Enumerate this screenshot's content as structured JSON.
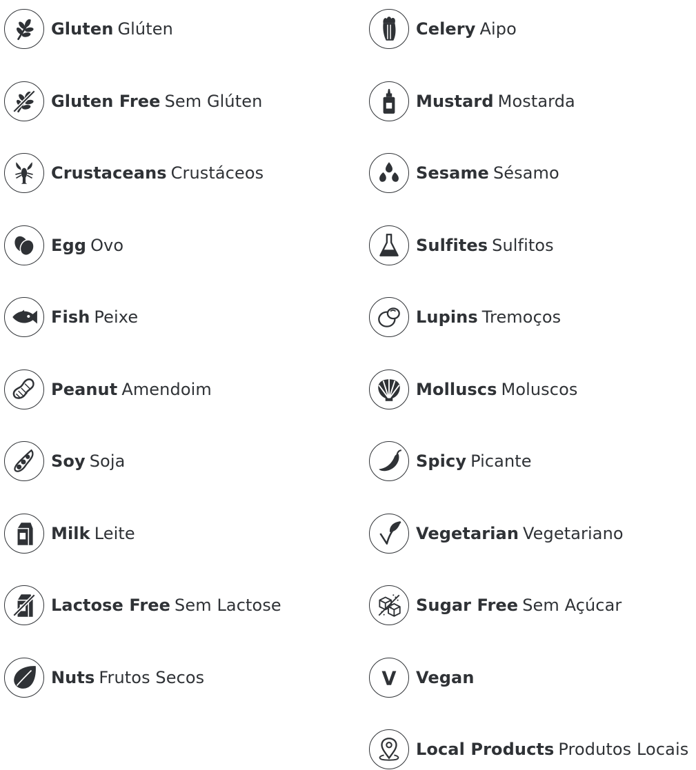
{
  "colors": {
    "ink": "#2f3236",
    "background": "#ffffff"
  },
  "columns": [
    {
      "items": [
        {
          "icon": "wheat-icon",
          "en": "Gluten",
          "pt": "Glúten"
        },
        {
          "icon": "wheat-crossed-icon",
          "en": "Gluten Free",
          "pt": "Sem Glúten"
        },
        {
          "icon": "lobster-icon",
          "en": "Crustaceans",
          "pt": "Crustáceos"
        },
        {
          "icon": "egg-icon",
          "en": "Egg",
          "pt": "Ovo"
        },
        {
          "icon": "fish-icon",
          "en": "Fish",
          "pt": "Peixe"
        },
        {
          "icon": "peanut-icon",
          "en": "Peanut",
          "pt": "Amendoim"
        },
        {
          "icon": "soy-pod-icon",
          "en": "Soy",
          "pt": "Soja"
        },
        {
          "icon": "milk-carton-icon",
          "en": "Milk",
          "pt": "Leite"
        },
        {
          "icon": "milk-carton-crossed-icon",
          "en": "Lactose Free",
          "pt": "Sem Lactose"
        },
        {
          "icon": "nut-icon",
          "en": "Nuts",
          "pt": "Frutos Secos"
        }
      ]
    },
    {
      "items": [
        {
          "icon": "celery-icon",
          "en": "Celery",
          "pt": "Aipo"
        },
        {
          "icon": "mustard-bottle-icon",
          "en": "Mustard",
          "pt": "Mostarda"
        },
        {
          "icon": "sesame-icon",
          "en": "Sesame",
          "pt": "Sésamo"
        },
        {
          "icon": "flask-icon",
          "en": "Sulfites",
          "pt": "Sulfitos"
        },
        {
          "icon": "lupin-icon",
          "en": "Lupins",
          "pt": "Tremoços"
        },
        {
          "icon": "shell-icon",
          "en": "Molluscs",
          "pt": "Moluscos"
        },
        {
          "icon": "chili-pepper-icon",
          "en": "Spicy",
          "pt": "Picante"
        },
        {
          "icon": "leaf-check-icon",
          "en": "Vegetarian",
          "pt": "Vegetariano"
        },
        {
          "icon": "sugar-cubes-crossed-icon",
          "en": "Sugar Free",
          "pt": "Sem Açúcar"
        },
        {
          "icon": "vegan-v-icon",
          "en": "Vegan",
          "pt": ""
        },
        {
          "icon": "location-pin-icon",
          "en": "Local Products",
          "pt": "Produtos Locais"
        }
      ]
    }
  ]
}
